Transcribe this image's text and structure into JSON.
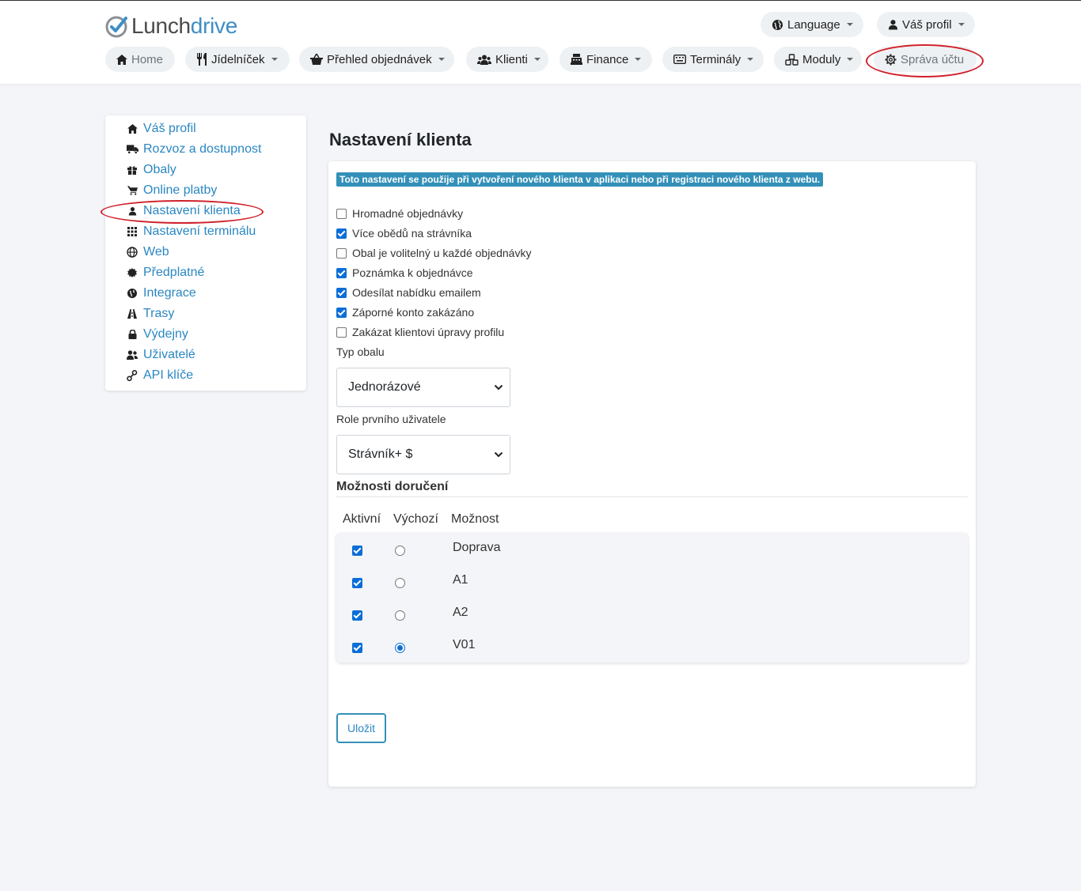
{
  "brand": {
    "part1": "Lunch",
    "part2": "drive"
  },
  "topnav": {
    "language": "Language",
    "profile": "Váš profil",
    "items": [
      "Home",
      "Jídelníček",
      "Přehled objednávek",
      "Klienti",
      "Finance",
      "Terminály",
      "Moduly",
      "Správa účtu"
    ]
  },
  "sidebar": {
    "items": [
      {
        "label": "Váš profil",
        "icon": "home-icon"
      },
      {
        "label": "Rozvoz a dostupnost",
        "icon": "truck-icon"
      },
      {
        "label": "Obaly",
        "icon": "gift-icon"
      },
      {
        "label": "Online platby",
        "icon": "cart-icon"
      },
      {
        "label": "Nastavení klienta",
        "icon": "user-icon"
      },
      {
        "label": "Nastavení terminálu",
        "icon": "grid-icon"
      },
      {
        "label": "Web",
        "icon": "globe-icon"
      },
      {
        "label": "Předplatné",
        "icon": "certificate-icon"
      },
      {
        "label": "Integrace",
        "icon": "globe-americas-icon"
      },
      {
        "label": "Trasy",
        "icon": "road-icon"
      },
      {
        "label": "Výdejny",
        "icon": "lock-icon"
      },
      {
        "label": "Uživatelé",
        "icon": "users-icon"
      },
      {
        "label": "API klíče",
        "icon": "key-icon"
      }
    ]
  },
  "main": {
    "title": "Nastavení klienta",
    "info": "Toto nastavení se použije při vytvoření nového klienta v aplikaci nebo při registraci nového klienta z webu.",
    "checkboxes": [
      {
        "label": "Hromadné objednávky",
        "checked": false
      },
      {
        "label": "Více obědů na strávníka",
        "checked": true
      },
      {
        "label": "Obal je volitelný u každé objednávky",
        "checked": false
      },
      {
        "label": "Poznámka k objednávce",
        "checked": true
      },
      {
        "label": "Odesílat nabídku emailem",
        "checked": true
      },
      {
        "label": "Záporné konto zakázáno",
        "checked": true
      },
      {
        "label": "Zakázat klientovi úpravy profilu",
        "checked": false
      }
    ],
    "packaging_label": "Typ obalu",
    "packaging_value": "Jednorázové",
    "role_label": "Role prvního uživatele",
    "role_value": "Strávník+ $",
    "delivery_heading": "Možnosti doručení",
    "columns": {
      "active": "Aktivní",
      "default": "Výchozí",
      "option": "Možnost"
    },
    "delivery_options": [
      {
        "name": "Doprava",
        "active": true,
        "default": false
      },
      {
        "name": "A1",
        "active": true,
        "default": false
      },
      {
        "name": "A2",
        "active": true,
        "default": false
      },
      {
        "name": "V01",
        "active": true,
        "default": true
      }
    ],
    "save_label": "Uložit"
  },
  "colors": {
    "accent": "#2a87c3",
    "annotation": "#d0202a",
    "badge": "#3390b8"
  }
}
